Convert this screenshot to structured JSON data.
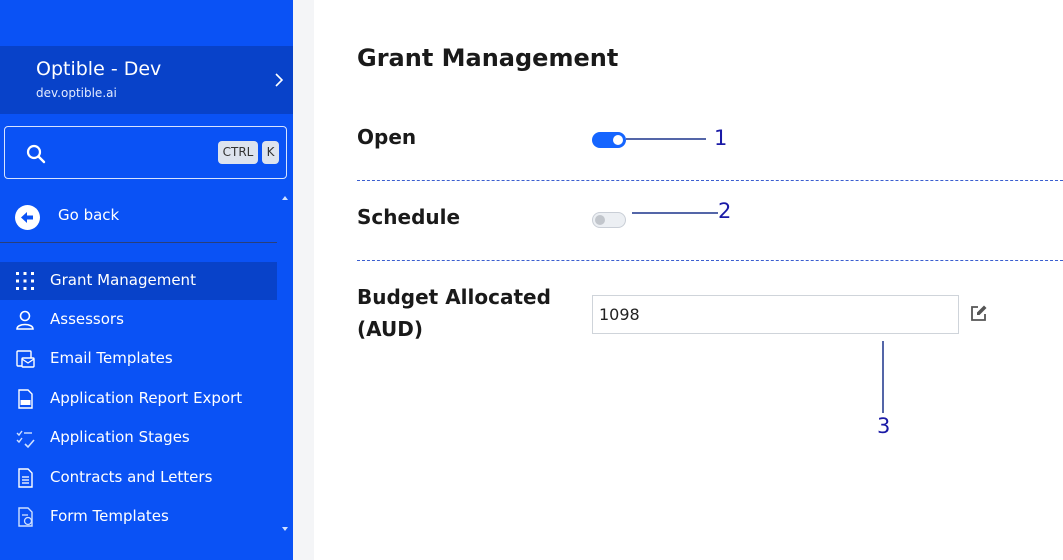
{
  "sidebar": {
    "org": {
      "name": "Optible - Dev",
      "url": "dev.optible.ai"
    },
    "search": {
      "shortcut_ctrl": "CTRL",
      "shortcut_key": "K"
    },
    "go_back_label": "Go back",
    "items": [
      {
        "label": "Grant Management",
        "icon": "grid-dots-icon",
        "active": true
      },
      {
        "label": "Assessors",
        "icon": "user-icon",
        "active": false
      },
      {
        "label": "Email Templates",
        "icon": "email-template-icon",
        "active": false
      },
      {
        "label": "Application Report Export",
        "icon": "pdf-file-icon",
        "active": false
      },
      {
        "label": "Application Stages",
        "icon": "stages-check-icon",
        "active": false
      },
      {
        "label": "Contracts and Letters",
        "icon": "document-icon",
        "active": false
      },
      {
        "label": "Form Templates",
        "icon": "form-template-icon",
        "active": false
      }
    ]
  },
  "main": {
    "title": "Grant Management",
    "open": {
      "label": "Open",
      "enabled": true
    },
    "schedule": {
      "label": "Schedule",
      "enabled": false
    },
    "budget": {
      "label_line1": "Budget Allocated",
      "label_line2": "(AUD)",
      "value": "1098"
    }
  },
  "annotations": [
    "1",
    "2",
    "3"
  ],
  "colors": {
    "sidebar_bg": "#0a52f5",
    "active_item_bg": "#0842c9",
    "toggle_on": "#1565ff",
    "annotation": "#1a1aa6"
  }
}
